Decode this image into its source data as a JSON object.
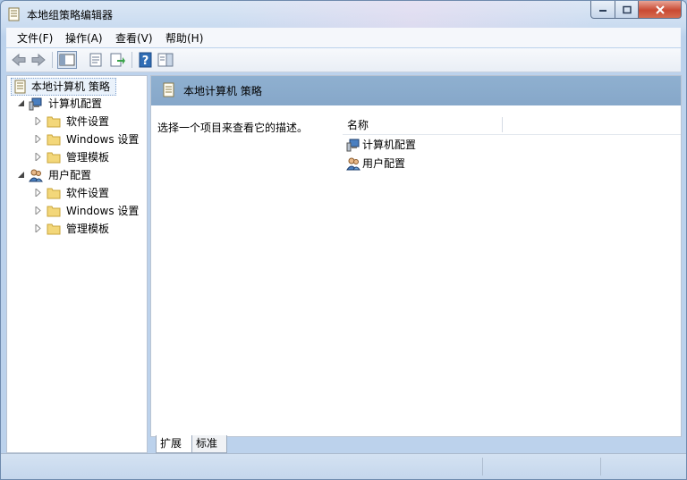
{
  "window": {
    "title": "本地组策略编辑器"
  },
  "menu": [
    {
      "label": "文件(F)"
    },
    {
      "label": "操作(A)"
    },
    {
      "label": "查看(V)"
    },
    {
      "label": "帮助(H)"
    }
  ],
  "tree": {
    "root": "本地计算机 策略",
    "computer": {
      "label": "计算机配置",
      "children": [
        "软件设置",
        "Windows 设置",
        "管理模板"
      ]
    },
    "user": {
      "label": "用户配置",
      "children": [
        "软件设置",
        "Windows 设置",
        "管理模板"
      ]
    }
  },
  "details": {
    "header": "本地计算机 策略",
    "description": "选择一个项目来查看它的描述。",
    "column_name": "名称",
    "rows": [
      "计算机配置",
      "用户配置"
    ]
  },
  "tabs": {
    "expand": "扩展",
    "standard": "标准"
  },
  "colors": {
    "header_band": "#8fb0d0",
    "folder": "#f3d77a",
    "accent": "#2f6db5"
  }
}
